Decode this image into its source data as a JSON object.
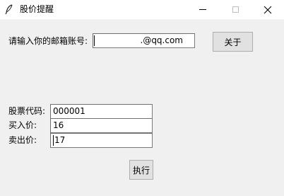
{
  "window": {
    "title": "股价提醒"
  },
  "email": {
    "label": "请输入你的邮箱账号:",
    "suffix": ".@qq.com"
  },
  "buttons": {
    "about": "关于",
    "run": "执行"
  },
  "form": {
    "code_label": "股票代码:",
    "code_value": "000001",
    "buy_label": "买入价:",
    "buy_value": "16",
    "sell_label": "卖出价:",
    "sell_value": "17"
  },
  "icons": {
    "app": "feather-icon",
    "minimize": "minimize-icon",
    "maximize": "maximize-icon",
    "close": "close-icon"
  }
}
